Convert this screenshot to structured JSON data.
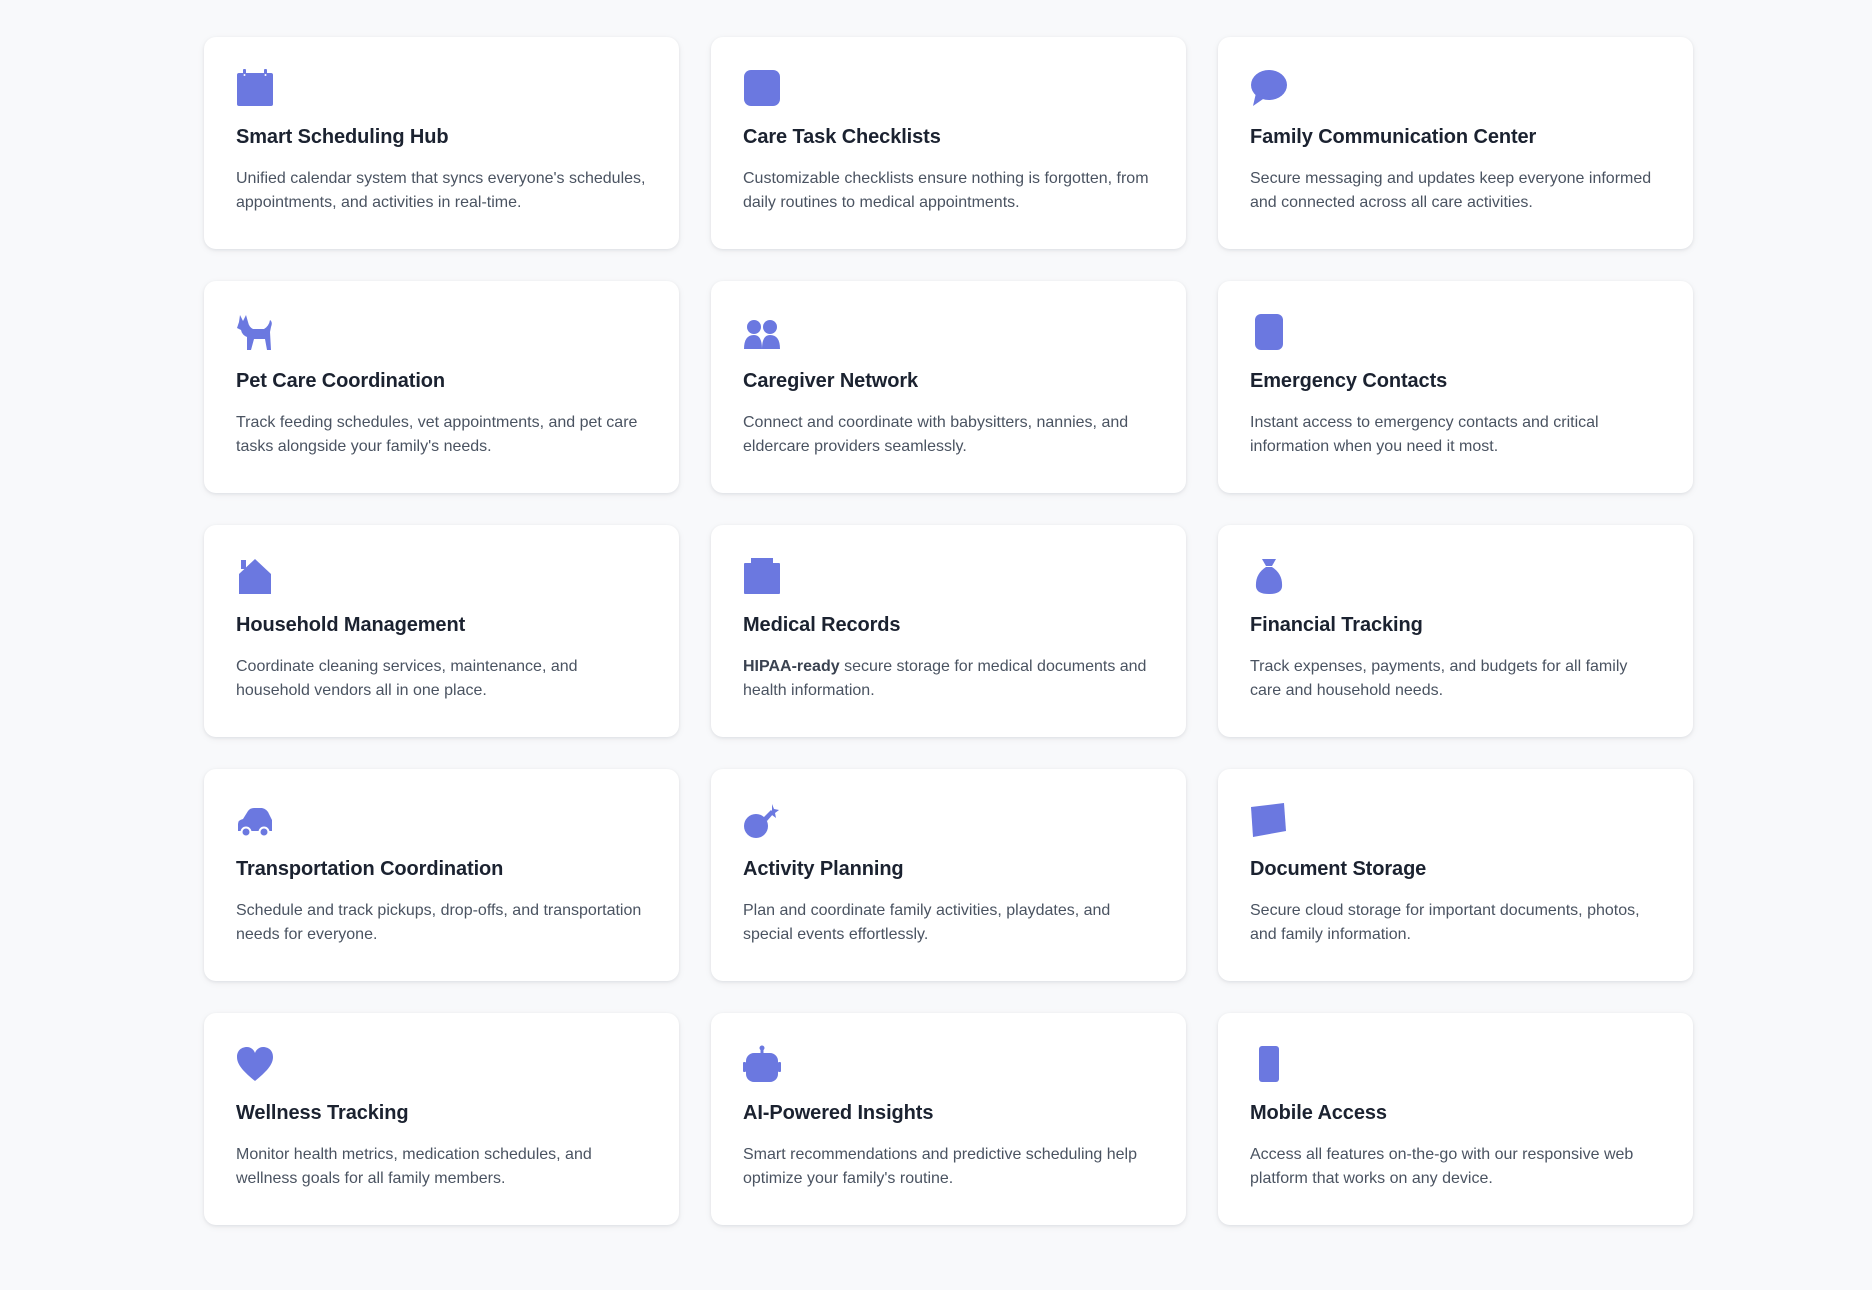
{
  "theme": {
    "accent": "#6b78e0",
    "card_background": "#ffffff",
    "page_background": "#f8f9fb",
    "title_color": "#1b2230",
    "text_color": "#4a5361"
  },
  "features": [
    {
      "icon": "calendar-icon",
      "title": "Smart Scheduling Hub",
      "desc_strong": "",
      "description": "Unified calendar system that syncs everyone's schedules, appointments, and activities in real-time."
    },
    {
      "icon": "checklist-icon",
      "title": "Care Task Checklists",
      "desc_strong": "",
      "description": "Customizable checklists ensure nothing is forgotten, from daily routines to medical appointments."
    },
    {
      "icon": "speech-bubble-icon",
      "title": "Family Communication Center",
      "desc_strong": "",
      "description": "Secure messaging and updates keep everyone informed and connected across all care activities."
    },
    {
      "icon": "dog-icon",
      "title": "Pet Care Coordination",
      "desc_strong": "",
      "description": "Track feeding schedules, vet appointments, and pet care tasks alongside your family's needs."
    },
    {
      "icon": "people-icon",
      "title": "Caregiver Network",
      "desc_strong": "",
      "description": "Connect and coordinate with babysitters, nannies, and eldercare providers seamlessly."
    },
    {
      "icon": "phone-icon",
      "title": "Emergency Contacts",
      "desc_strong": "",
      "description": "Instant access to emergency contacts and critical information when you need it most."
    },
    {
      "icon": "house-icon",
      "title": "Household Management",
      "desc_strong": "",
      "description": "Coordinate cleaning services, maintenance, and household vendors all in one place."
    },
    {
      "icon": "hospital-icon",
      "title": "Medical Records",
      "desc_strong": "HIPAA-ready",
      "description": " secure storage for medical documents and health information."
    },
    {
      "icon": "money-bag-icon",
      "title": "Financial Tracking",
      "desc_strong": "",
      "description": "Track expenses, payments, and budgets for all family care and household needs."
    },
    {
      "icon": "car-icon",
      "title": "Transportation Coordination",
      "desc_strong": "",
      "description": "Schedule and track pickups, drop-offs, and transportation needs for everyone."
    },
    {
      "icon": "party-popper-icon",
      "title": "Activity Planning",
      "desc_strong": "",
      "description": "Plan and coordinate family activities, playdates, and special events effortlessly."
    },
    {
      "icon": "folder-icon",
      "title": "Document Storage",
      "desc_strong": "",
      "description": "Secure cloud storage for important documents, photos, and family information."
    },
    {
      "icon": "heart-icon",
      "title": "Wellness Tracking",
      "desc_strong": "",
      "description": "Monitor health metrics, medication schedules, and wellness goals for all family members."
    },
    {
      "icon": "robot-icon",
      "title": "AI-Powered Insights",
      "desc_strong": "",
      "description": "Smart recommendations and predictive scheduling help optimize your family's routine."
    },
    {
      "icon": "mobile-icon",
      "title": "Mobile Access",
      "desc_strong": "",
      "description": "Access all features on-the-go with our responsive web platform that works on any device."
    }
  ]
}
